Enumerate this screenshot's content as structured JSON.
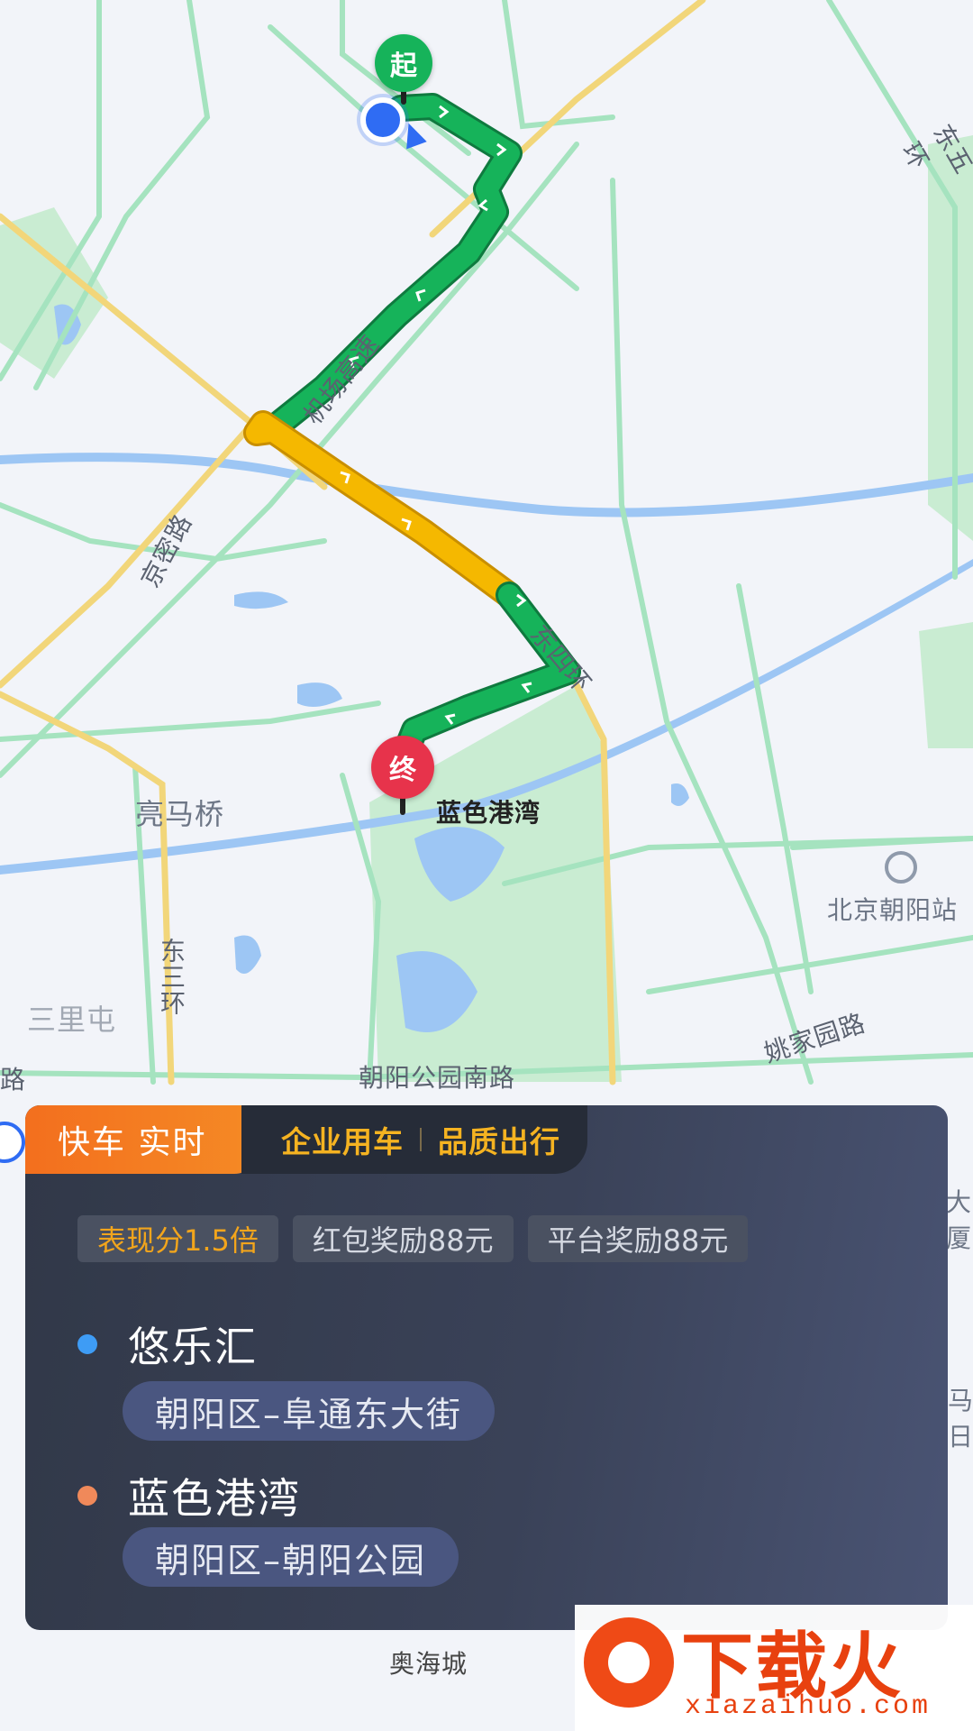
{
  "map": {
    "labels": {
      "east_5th_ring": "东五环",
      "airport_expressway": "机场高速",
      "jingmi_road": "京密路",
      "east_4th_ring": "东四环",
      "liangmaqiao": "亮马桥",
      "east_3rd_ring": "东三环",
      "sanlitun": "三里屯",
      "chaoyang_park_south_rd": "朝阳公园南路",
      "yaojiayuan_rd": "姚家园路",
      "beijing_chaoyang_station": "北京朝阳站",
      "aohaicheng": "奥海城",
      "destination_label": "蓝色港湾",
      "road_edge_left": "路",
      "right_edge_1": "大厦",
      "right_edge_2": "马日"
    },
    "start_pin": "起",
    "end_pin": "终",
    "route_colors": {
      "smooth": "#16b35a",
      "slow": "#f5b800"
    }
  },
  "panel": {
    "tabs": {
      "active": "快车 实时",
      "items": [
        "企业用车",
        "品质出行"
      ]
    },
    "chips": [
      "表现分1.5倍",
      "红包奖励88元",
      "平台奖励88元"
    ],
    "origin": {
      "name": "悠乐汇",
      "address": "朝阳区–阜通东大街",
      "dot_color": "#3e9cf5"
    },
    "destination": {
      "name": "蓝色港湾",
      "address": "朝阳区–朝阳公园",
      "dot_color": "#f0895a"
    }
  },
  "watermark": {
    "main": "下载火",
    "sub": "xiazaihuo.com"
  }
}
